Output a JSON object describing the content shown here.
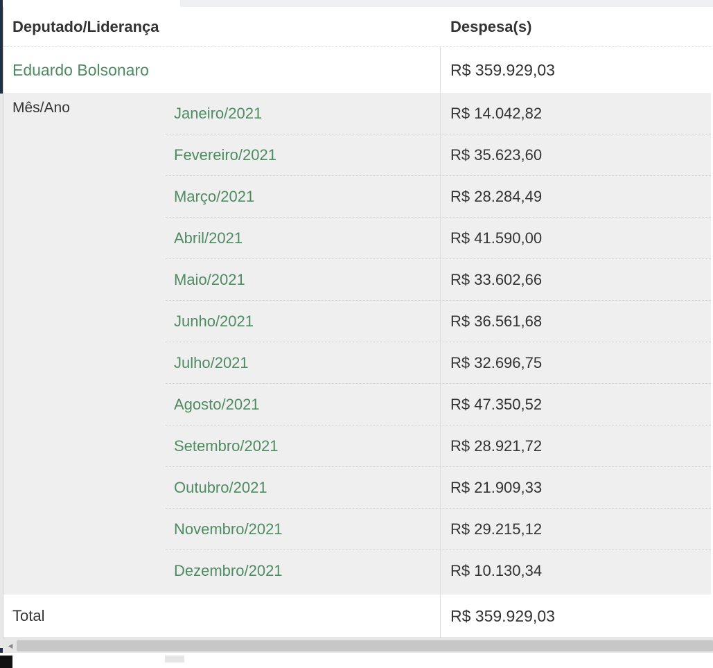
{
  "table": {
    "header": {
      "col_deputado": "Deputado/Liderança",
      "col_despesas": "Despesa(s)"
    },
    "deputado": {
      "name": "Eduardo Bolsonaro",
      "total": "R$ 359.929,03"
    },
    "mes_ano_label": "Mês/Ano",
    "months": [
      {
        "label": "Janeiro/2021",
        "value": "R$ 14.042,82"
      },
      {
        "label": "Fevereiro/2021",
        "value": "R$ 35.623,60"
      },
      {
        "label": "Março/2021",
        "value": "R$ 28.284,49"
      },
      {
        "label": "Abril/2021",
        "value": "R$ 41.590,00"
      },
      {
        "label": "Maio/2021",
        "value": "R$ 33.602,66"
      },
      {
        "label": "Junho/2021",
        "value": "R$ 36.561,68"
      },
      {
        "label": "Julho/2021",
        "value": "R$ 32.696,75"
      },
      {
        "label": "Agosto/2021",
        "value": "R$ 47.350,52"
      },
      {
        "label": "Setembro/2021",
        "value": "R$ 28.921,72"
      },
      {
        "label": "Outubro/2021",
        "value": "R$ 21.909,33"
      },
      {
        "label": "Novembro/2021",
        "value": "R$ 29.215,12"
      },
      {
        "label": "Dezembro/2021",
        "value": "R$ 10.130,34"
      }
    ],
    "total": {
      "label": "Total",
      "value": "R$ 359.929,03"
    }
  },
  "scrollbar": {
    "left_arrow_icon": "chevron-left-icon"
  },
  "colors": {
    "link_green": "#4e8b62",
    "row_shade": "#efefef",
    "text": "#333333"
  }
}
